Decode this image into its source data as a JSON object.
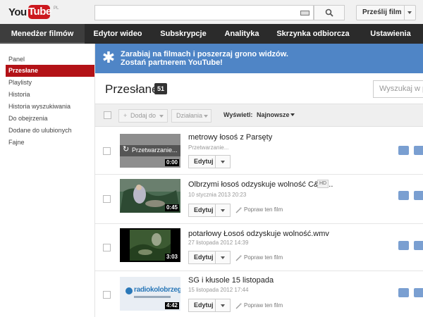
{
  "header": {
    "logo_you": "You",
    "logo_tube": "Tube",
    "logo_country": "PL",
    "search_placeholder": "",
    "upload_label": "Prześlij film"
  },
  "nav": {
    "tabs": [
      {
        "label": "Menedżer filmów",
        "active": true
      },
      {
        "label": "Edytor wideo"
      },
      {
        "label": "Subskrypcje"
      },
      {
        "label": "Analityka"
      },
      {
        "label": "Skrzynka odbiorcza"
      },
      {
        "label": "Ustawienia"
      }
    ]
  },
  "sidebar": {
    "items": [
      {
        "label": "Panel"
      },
      {
        "label": "Przesłane",
        "active": true
      },
      {
        "label": "Playlisty"
      },
      {
        "label": "Historia"
      },
      {
        "label": "Historia wyszukiwania"
      },
      {
        "label": "Do obejrzenia"
      },
      {
        "label": "Dodane do ulubionych"
      },
      {
        "label": "Fajne"
      }
    ]
  },
  "promo": {
    "line1": "Zarabiaj na filmach i poszerzaj grono widzów.",
    "line2": "Zostań partnerem YouTube!",
    "icon": "star-icon"
  },
  "main": {
    "title": "Przesłane",
    "count": "51",
    "search_placeholder": "Wyszukaj w prz"
  },
  "toolbar": {
    "add_to": "Dodaj do",
    "actions": "Działania",
    "view_label": "Wyświetl:",
    "view_value": "Najnowsze"
  },
  "videos": [
    {
      "title": "metrowy łosoś z Parsęty",
      "date": "Przetwarzanie...",
      "duration": "0:00",
      "processing_label": "Przetwarzanie...",
      "edit_label": "Edytuj",
      "improve_label": "",
      "hd": ""
    },
    {
      "title": "Olbrzymi łosoś odzyskuje wolność C&R ...",
      "date": "10 stycznia 2013 20:23",
      "duration": "0:45",
      "edit_label": "Edytuj",
      "improve_label": "Popraw ten film",
      "hd": "HD"
    },
    {
      "title": "potarłowy Łosoś odzyskuje wolność.wmv",
      "date": "27 listopada 2012 14:39",
      "duration": "3:03",
      "edit_label": "Edytuj",
      "improve_label": "Popraw ten film",
      "hd": ""
    },
    {
      "title": "SG i kłusole 15 listopada",
      "date": "15 listopada 2012 17:44",
      "duration": "4:42",
      "edit_label": "Edytuj",
      "improve_label": "Popraw ten film",
      "hd": "",
      "thumb_text": "radiokolobrzeg"
    }
  ],
  "colors": {
    "accent_red": "#b31217",
    "nav_dark": "#2b2b2b",
    "promo_blue": "#4f85c6",
    "action_blue": "#7a9fd1"
  }
}
